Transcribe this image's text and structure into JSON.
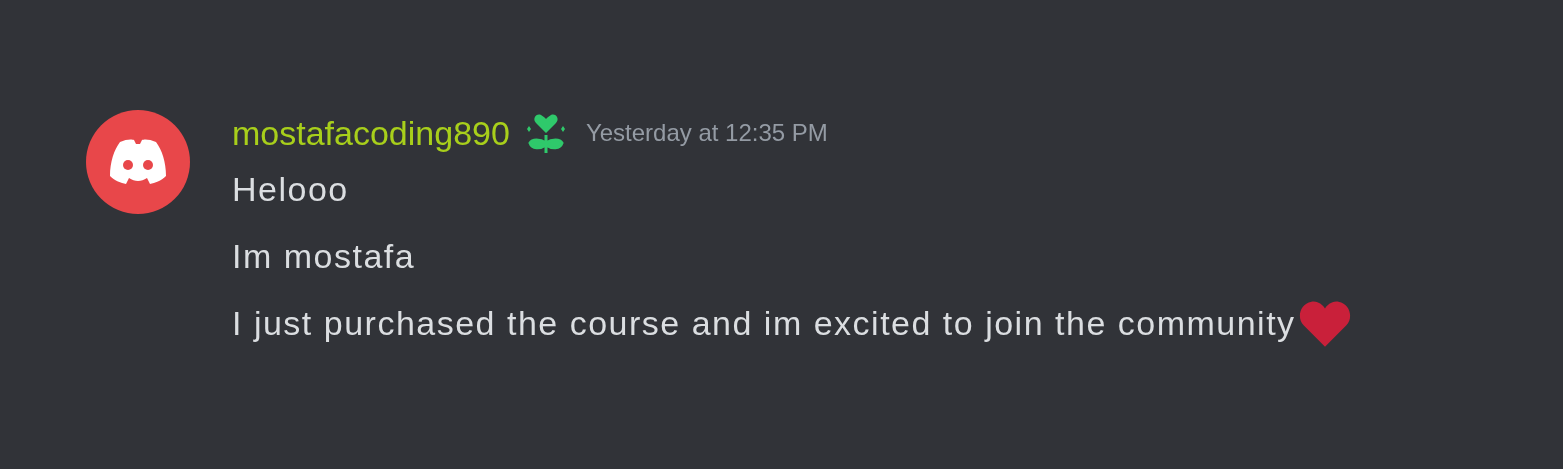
{
  "message": {
    "author": "mostafacoding890",
    "timestamp": "Yesterday at 12:35 PM",
    "lines": [
      {
        "text": "Helooo",
        "kind": "plain"
      },
      {
        "text": "Im mostafa",
        "kind": "plain"
      },
      {
        "text": "I just purchased the course and im excited to join the community",
        "kind": "with-heart"
      }
    ]
  }
}
